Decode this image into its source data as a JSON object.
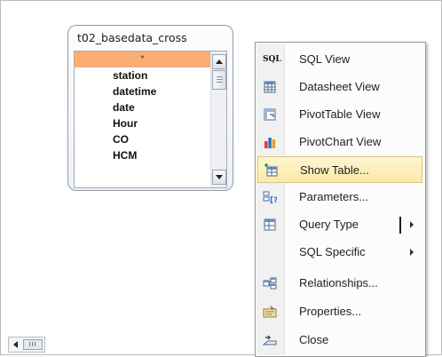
{
  "table": {
    "title": "t02_basedata_cross",
    "fields": [
      "*",
      "station",
      "datetime",
      "date",
      "Hour",
      "CO",
      "HCM"
    ]
  },
  "menu": {
    "items": [
      {
        "label": "SQL View",
        "icon": "sql-icon"
      },
      {
        "label": "Datasheet View",
        "icon": "datasheet-icon"
      },
      {
        "label": "PivotTable View",
        "icon": "pivottable-icon"
      },
      {
        "label": "PivotChart View",
        "icon": "pivotchart-icon"
      },
      {
        "label": "Show Table...",
        "icon": "show-table-icon",
        "highlighted": true
      },
      {
        "label": "Parameters...",
        "icon": "parameters-icon"
      },
      {
        "label": "Query Type",
        "icon": "query-type-icon",
        "submenu": true
      },
      {
        "label": "SQL Specific",
        "submenu": true
      },
      {
        "label": "Relationships...",
        "icon": "relationships-icon"
      },
      {
        "label": "Properties...",
        "icon": "properties-icon"
      },
      {
        "label": "Close",
        "icon": "close-icon"
      }
    ],
    "sql_icon_text": "SQL"
  },
  "colors": {
    "selected_field": "#fbae73",
    "highlight": "#fbe9a5"
  }
}
